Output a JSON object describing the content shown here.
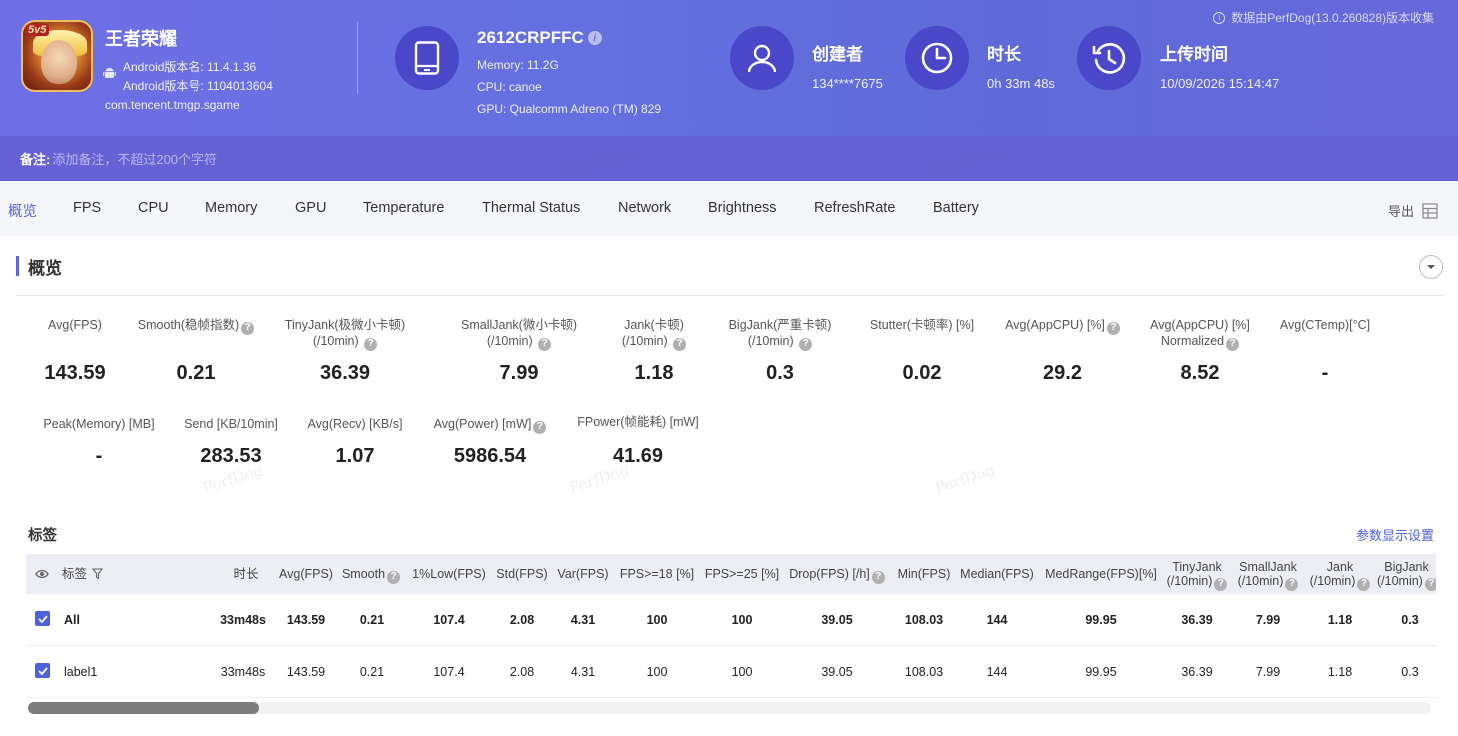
{
  "app": {
    "name": "王者荣耀",
    "icon_badge": "5v5",
    "version_name": "Android版本名: 11.4.1.36",
    "version_code": "Android版本号: 1104013604",
    "package": "com.tencent.tmgp.sgame"
  },
  "device": {
    "name": "2612CRPFFC",
    "info_glyph": "i",
    "memory": "Memory: 11.2G",
    "cpu": "CPU: canoe",
    "gpu": "GPU: Qualcomm Adreno (TM) 829"
  },
  "creator": {
    "title": "创建者",
    "value": "134****7675"
  },
  "duration": {
    "title": "时长",
    "value": "0h 33m 48s"
  },
  "upload": {
    "title": "上传时间",
    "value": "10/09/2026 15:14:47"
  },
  "collect_note": "数据由PerfDog(13.0.260828)版本收集",
  "memo": {
    "label": "备注:",
    "placeholder": "添加备注，不超过200个字符"
  },
  "watermark": "PerfDog",
  "tabs": [
    "概览",
    "FPS",
    "CPU",
    "Memory",
    "GPU",
    "Temperature",
    "Thermal Status",
    "Network",
    "Brightness",
    "RefreshRate",
    "Battery"
  ],
  "export_label": "导出",
  "overview": {
    "title": "概览",
    "stats": [
      {
        "line1": "",
        "line2": "Avg(FPS)",
        "value": "143.59"
      },
      {
        "line1": "",
        "line2": "Smooth(稳帧指数)",
        "value": "0.21"
      },
      {
        "line1": "TinyJank(极微小卡顿)",
        "line2": "(/10min)",
        "value": "36.39"
      },
      {
        "line1": "SmallJank(微小卡顿)",
        "line2": "(/10min)",
        "value": "7.99"
      },
      {
        "line1": "Jank(卡顿)",
        "line2": "(/10min)",
        "value": "1.18"
      },
      {
        "line1": "BigJank(严重卡顿)",
        "line2": "(/10min)",
        "value": "0.3"
      },
      {
        "line1": "",
        "line2": "Stutter(卡顿率) [%]",
        "value": "0.02"
      },
      {
        "line1": "",
        "line2": "Avg(AppCPU) [%]",
        "value": "29.2"
      },
      {
        "line1": "Avg(AppCPU) [%]",
        "line2": "Normalized",
        "value": "8.52"
      },
      {
        "line1": "",
        "line2": "Avg(CTemp)[°C]",
        "value": "-"
      },
      {
        "line1": "",
        "line2": "Peak(Memory) [MB]",
        "value": "-"
      },
      {
        "line1": "",
        "line2": "Send [KB/10min]",
        "value": "283.53"
      },
      {
        "line1": "",
        "line2": "Avg(Recv) [KB/s]",
        "value": "1.07"
      },
      {
        "line1": "",
        "line2": "Avg(Power) [mW]",
        "value": "5986.54"
      },
      {
        "line1": "",
        "line2": "FPower(帧能耗) [mW]",
        "value": "41.69"
      }
    ]
  },
  "labels": {
    "title": "标签",
    "settings_link": "参数显示设置",
    "columns": [
      {
        "line1": "标签",
        "line2": ""
      },
      {
        "line1": "时长",
        "line2": ""
      },
      {
        "line1": "Avg(FPS)",
        "line2": ""
      },
      {
        "line1": "Smooth",
        "line2": ""
      },
      {
        "line1": "1%Low(FPS)",
        "line2": ""
      },
      {
        "line1": "Std(FPS)",
        "line2": ""
      },
      {
        "line1": "Var(FPS)",
        "line2": ""
      },
      {
        "line1": "FPS>=18 [%]",
        "line2": ""
      },
      {
        "line1": "FPS>=25 [%]",
        "line2": ""
      },
      {
        "line1": "Drop(FPS) [/h]",
        "line2": ""
      },
      {
        "line1": "Min(FPS)",
        "line2": ""
      },
      {
        "line1": "Median(FPS)",
        "line2": ""
      },
      {
        "line1": "MedRange(FPS)[%]",
        "line2": ""
      },
      {
        "line1": "TinyJank",
        "line2": "(/10min)"
      },
      {
        "line1": "SmallJank",
        "line2": "(/10min)"
      },
      {
        "line1": "Jank",
        "line2": "(/10min)"
      },
      {
        "line1": "BigJank",
        "line2": "(/10min)"
      }
    ],
    "rows": [
      {
        "cells": [
          "All",
          "33m48s",
          "143.59",
          "0.21",
          "107.4",
          "2.08",
          "4.31",
          "100",
          "100",
          "39.05",
          "108.03",
          "144",
          "99.95",
          "36.39",
          "7.99",
          "1.18",
          "0.3"
        ]
      },
      {
        "cells": [
          "label1",
          "33m48s",
          "143.59",
          "0.21",
          "107.4",
          "2.08",
          "4.31",
          "100",
          "100",
          "39.05",
          "108.03",
          "144",
          "99.95",
          "36.39",
          "7.99",
          "1.18",
          "0.3"
        ]
      }
    ]
  },
  "colors": {
    "header_bg": "#6a6ce0",
    "accent": "#5a67e0",
    "link": "#4a5fd9",
    "checkbox": "#4b62db"
  },
  "icons": {
    "device": "phone-icon",
    "creator": "user-icon",
    "duration": "clock-icon",
    "upload": "history-icon",
    "export": "table-export-icon"
  }
}
